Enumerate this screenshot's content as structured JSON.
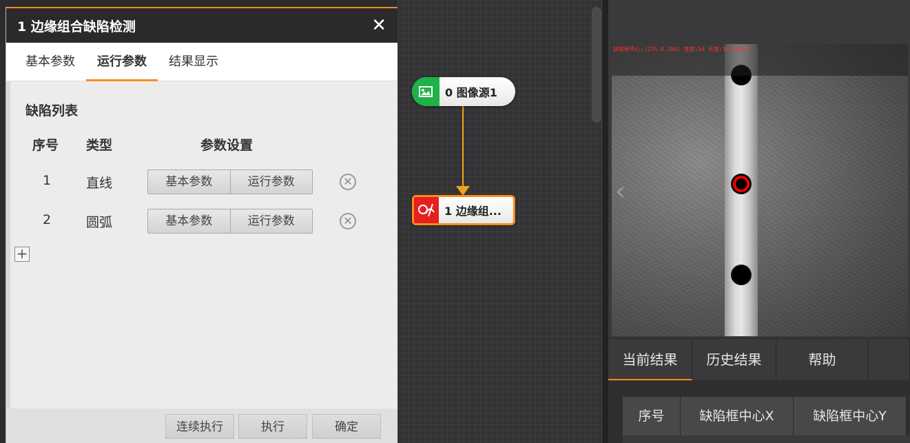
{
  "dialog": {
    "title": "1 边缘组合缺陷检测",
    "close_glyph": "✕",
    "tabs": [
      {
        "label": "基本参数"
      },
      {
        "label": "运行参数"
      },
      {
        "label": "结果显示"
      }
    ],
    "section_title": "缺陷列表",
    "columns": {
      "index": "序号",
      "type": "类型",
      "params": "参数设置"
    },
    "rows": [
      {
        "index": "1",
        "type": "直线",
        "btn_basic": "基本参数",
        "btn_run": "运行参数"
      },
      {
        "index": "2",
        "type": "圆弧",
        "btn_basic": "基本参数",
        "btn_run": "运行参数"
      }
    ],
    "footer": {
      "continuous": "连续执行",
      "execute": "执行",
      "confirm": "确定"
    }
  },
  "flow": {
    "node_source": "0 图像源1",
    "node_edge": "1 边缘组..."
  },
  "results": {
    "tabs": [
      {
        "label": "当前结果"
      },
      {
        "label": "历史结果"
      },
      {
        "label": "帮助"
      },
      {
        "label": ""
      }
    ],
    "columns": [
      "序号",
      "缺陷框中心X",
      "缺陷框中心Y"
    ]
  },
  "image": {
    "overlay_text": "缺陷框中心:(235.0,260) 宽度:54 长度:16 角度:0"
  },
  "colors": {
    "accent": "#ff8a1c",
    "source_node": "#1fb248",
    "edge_node": "#e52020"
  }
}
